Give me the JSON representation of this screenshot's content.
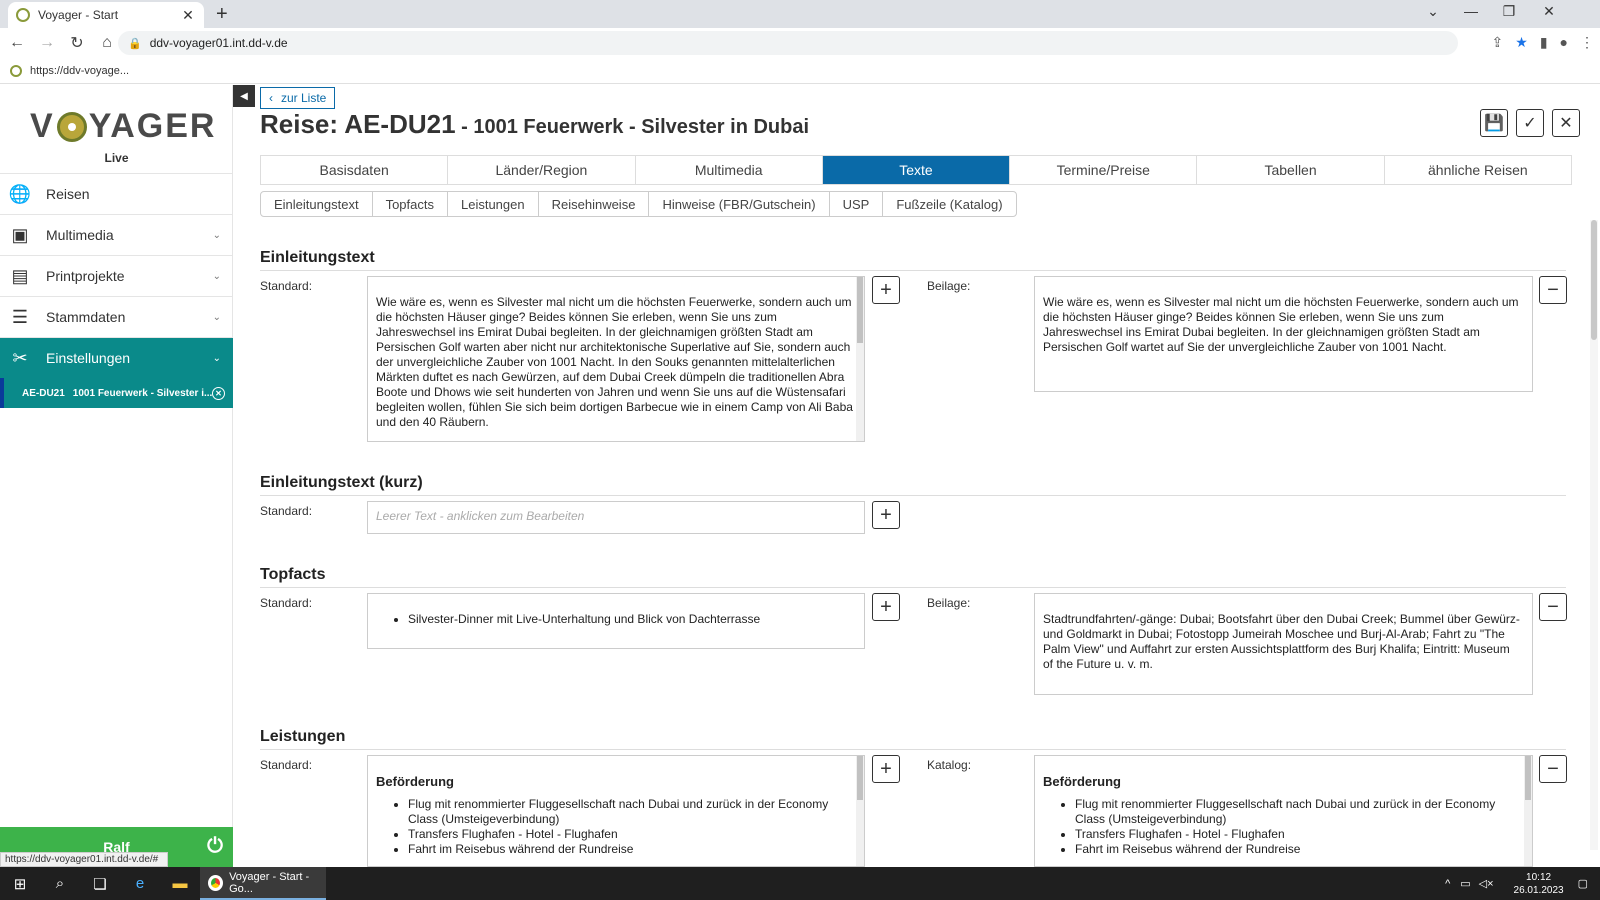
{
  "browser": {
    "tab_title": "Voyager - Start",
    "url": "ddv-voyager01.int.dd-v.de",
    "info_url": "https://ddv-voyage...",
    "status_url": "https://ddv-voyager01.int.dd-v.de/#"
  },
  "sidebar": {
    "logo_pre": "V",
    "logo_post": "YAGER",
    "logo_sub": "Live",
    "items": [
      {
        "label": "Reisen",
        "icon": "globe-icon"
      },
      {
        "label": "Multimedia",
        "icon": "images-icon"
      },
      {
        "label": "Printprojekte",
        "icon": "book-icon"
      },
      {
        "label": "Stammdaten",
        "icon": "database-icon"
      },
      {
        "label": "Einstellungen",
        "icon": "tools-icon"
      }
    ],
    "open_item": {
      "code": "AE-DU21",
      "name": "1001 Feuerwerk - Silvester i..."
    },
    "user": "Ralf"
  },
  "header": {
    "back_label": "zur Liste",
    "title_main": "Reise: AE-DU21",
    "title_sub": " - 1001 Feuerwerk - Silvester in Dubai"
  },
  "tabs": [
    "Basisdaten",
    "Länder/Region",
    "Multimedia",
    "Texte",
    "Termine/Preise",
    "Tabellen",
    "ähnliche Reisen"
  ],
  "subtabs": [
    "Einleitungstext",
    "Topfacts",
    "Leistungen",
    "Reisehinweise",
    "Hinweise (FBR/Gutschein)",
    "USP",
    "Fußzeile (Katalog)"
  ],
  "sections": {
    "einleitung": {
      "title": "Einleitungstext",
      "std_label": "Standard:",
      "std_text": "Wie wäre es, wenn es Silvester mal nicht um die höchsten Feuerwerke, sondern auch um die höchsten Häuser ginge? Beides können Sie erleben, wenn Sie uns zum Jahreswechsel ins Emirat Dubai begleiten. In der gleichnamigen größten Stadt am Persischen Golf warten aber nicht nur architektonische Superlative auf Sie, sondern auch der unvergleichliche Zauber von 1001 Nacht. In den Souks genannten mittelalterlichen Märkten duftet es nach Gewürzen, auf dem Dubai Creek dümpeln die traditionellen Abra Boote und Dhows wie seit hunderten von Jahren und wenn Sie uns auf die Wüstensafari begleiten wollen, fühlen Sie sich beim dortigen Barbecue wie in einem Camp von Ali Baba und den 40 Räubern.",
      "alt_label": "Beilage:",
      "alt_text": "Wie wäre es, wenn es Silvester mal nicht um die höchsten Feuerwerke, sondern auch um die höchsten Häuser ginge? Beides können Sie erleben, wenn Sie uns zum Jahreswechsel ins Emirat Dubai begleiten. In der gleichnamigen größten Stadt am Persischen Golf wartet auf Sie der unvergleichliche Zauber von 1001 Nacht."
    },
    "kurz": {
      "title": "Einleitungstext (kurz)",
      "std_label": "Standard:",
      "placeholder": "Leerer Text - anklicken zum Bearbeiten"
    },
    "topfacts": {
      "title": "Topfacts",
      "std_label": "Standard:",
      "std_item": "Silvester-Dinner mit Live-Unterhaltung und Blick von Dachterrasse",
      "alt_label": "Beilage:",
      "alt_text": "Stadtrundfahrten/-gänge: Dubai; Bootsfahrt über den Dubai Creek; Bummel über Gewürz- und Goldmarkt in Dubai; Fotostopp Jumeirah Moschee und Burj-Al-Arab; Fahrt zu \"The Palm View\" und Auffahrt zur ersten Aussichtsplattform des Burj Khalifa; Eintritt: Museum of the Future u. v. m."
    },
    "leistungen": {
      "title": "Leistungen",
      "std_label": "Standard:",
      "alt_label": "Katalog:",
      "heading": "Beförderung",
      "items": [
        "Flug mit renommierter Fluggesellschaft nach Dubai und zurück in der Economy Class (Umsteigeverbindung)",
        "Transfers Flughafen - Hotel - Flughafen",
        "Fahrt im Reisebus während der Rundreise"
      ]
    }
  },
  "taskbar": {
    "app_label": "Voyager - Start - Go...",
    "time": "10:12",
    "date": "26.01.2023"
  }
}
